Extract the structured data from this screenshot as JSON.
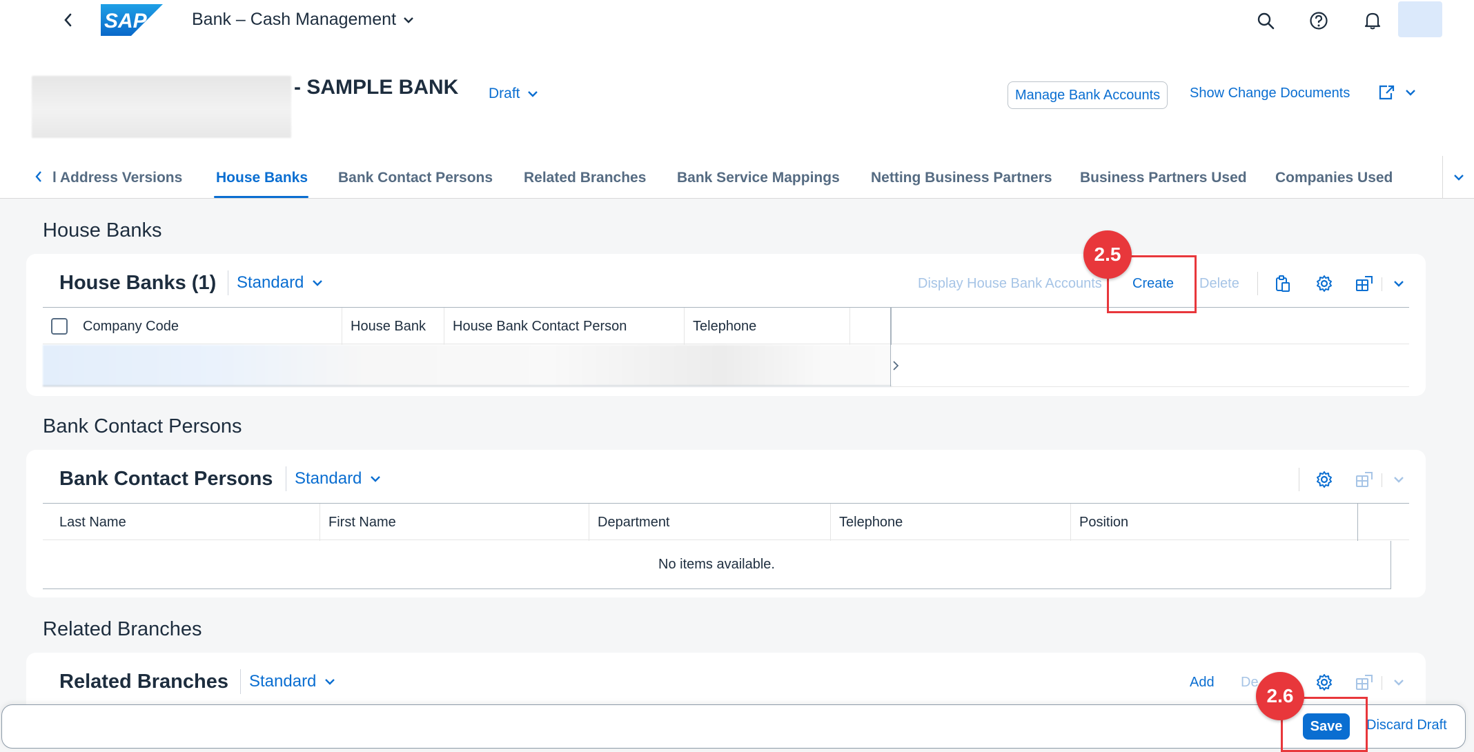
{
  "shell": {
    "app_title": "Bank – Cash Management",
    "logo_text": "SAP"
  },
  "header": {
    "object_title": "- SAMPLE BANK",
    "status": "Draft",
    "manage_accounts": "Manage Bank Accounts",
    "change_docs": "Show Change Documents"
  },
  "tabs": [
    {
      "label": "l Address Versions"
    },
    {
      "label": "House Banks"
    },
    {
      "label": "Bank Contact Persons"
    },
    {
      "label": "Related Branches"
    },
    {
      "label": "Bank Service Mappings"
    },
    {
      "label": "Netting Business Partners"
    },
    {
      "label": "Business Partners Used"
    },
    {
      "label": "Companies Used"
    }
  ],
  "house_banks": {
    "section_title": "House Banks",
    "card_title": "House Banks (1)",
    "variant": "Standard",
    "display_accounts": "Display House Bank Accounts",
    "create": "Create",
    "delete": "Delete",
    "columns": [
      "Company Code",
      "House Bank",
      "House Bank Contact Person",
      "Telephone"
    ]
  },
  "contacts": {
    "section_title": "Bank Contact Persons",
    "card_title": "Bank Contact Persons",
    "variant": "Standard",
    "columns": [
      "Last Name",
      "First Name",
      "Department",
      "Telephone",
      "Position"
    ],
    "empty_text": "No items available."
  },
  "branches": {
    "section_title": "Related Branches",
    "card_title": "Related Branches",
    "variant": "Standard",
    "add": "Add",
    "delete_partial": "De"
  },
  "annotations": {
    "step_create": "2.5",
    "step_save": "2.6",
    "color": "#e8373b"
  },
  "footer": {
    "save": "Save",
    "discard": "Discard Draft"
  },
  "colors": {
    "accent": "#0a6ed1",
    "text": "#1d2d3e",
    "disabled": "#a6c4e6"
  }
}
